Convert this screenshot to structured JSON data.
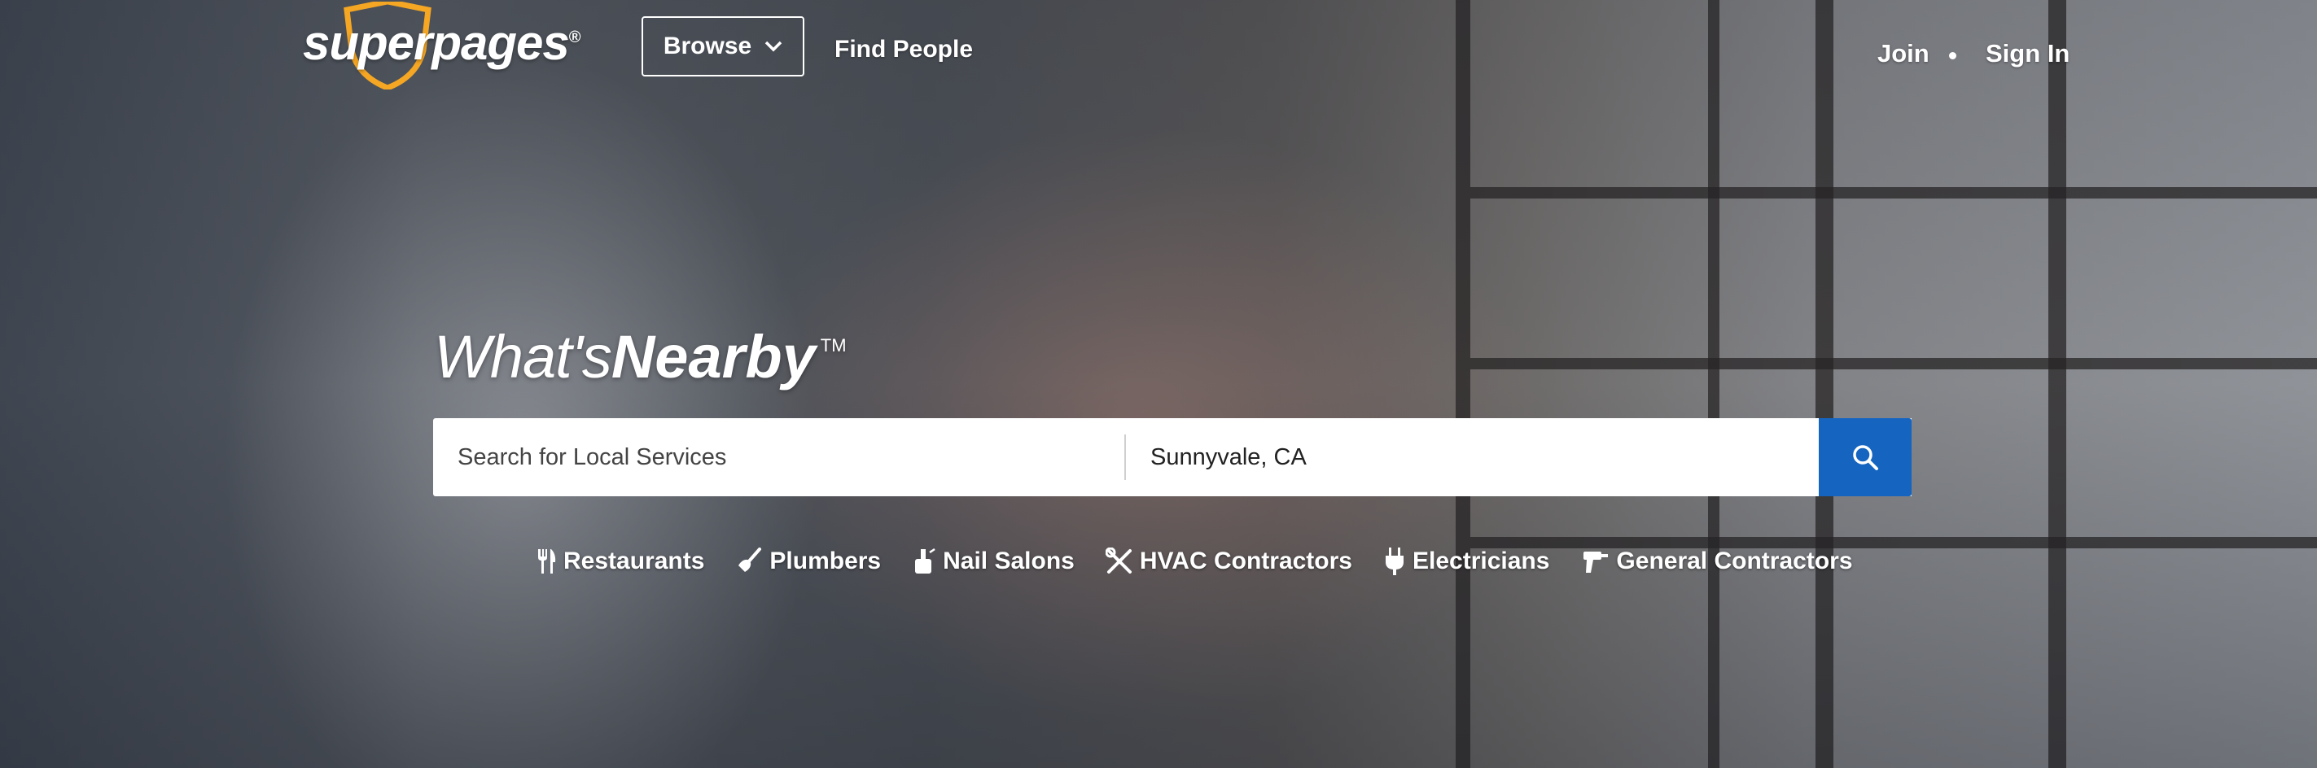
{
  "brand": {
    "name": "superpages",
    "registered_mark": "®",
    "accent_color": "#f5a623"
  },
  "header": {
    "browse_label": "Browse",
    "find_people_label": "Find People",
    "join_label": "Join",
    "sign_in_label": "Sign In"
  },
  "hero": {
    "tagline_light": "What's",
    "tagline_bold": "Nearby",
    "tagline_tm": "TM"
  },
  "search": {
    "service_placeholder": "Search for Local Services",
    "service_value": "",
    "location_value": "Sunnyvale, CA",
    "button_icon": "search-icon",
    "button_color": "#1565c0"
  },
  "categories": [
    {
      "label": "Restaurants",
      "icon": "fork-knife-icon"
    },
    {
      "label": "Plumbers",
      "icon": "plunger-icon"
    },
    {
      "label": "Nail Salons",
      "icon": "nail-polish-icon"
    },
    {
      "label": "HVAC Contractors",
      "icon": "tools-icon"
    },
    {
      "label": "Electricians",
      "icon": "plug-icon"
    },
    {
      "label": "General Contractors",
      "icon": "drill-icon"
    }
  ]
}
